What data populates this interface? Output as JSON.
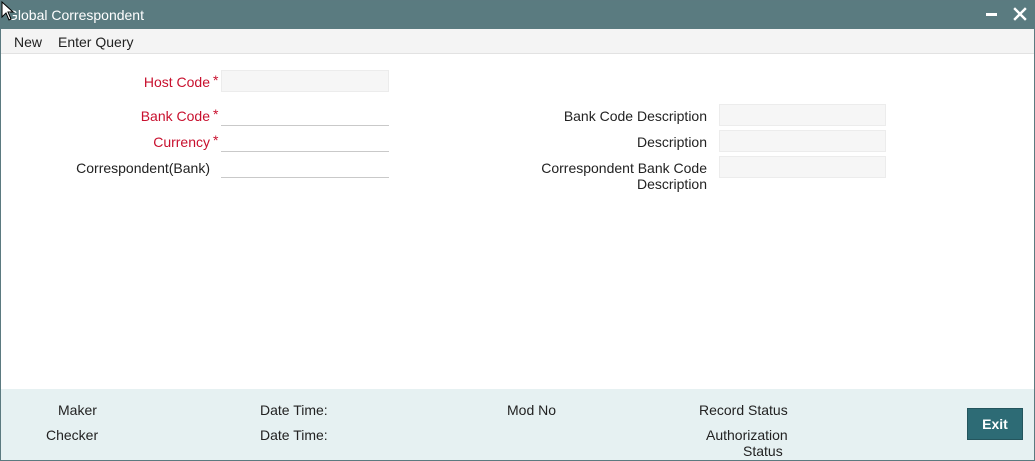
{
  "window": {
    "title": "Global Correspondent",
    "minimize_glyph": "▬",
    "close_glyph": "✕"
  },
  "menu": {
    "new": "New",
    "enter_query": "Enter Query"
  },
  "form": {
    "host_code": {
      "label": "Host Code",
      "required_mark": "*",
      "value": ""
    },
    "bank_code": {
      "label": "Bank Code",
      "required_mark": "*",
      "value": ""
    },
    "currency": {
      "label": "Currency",
      "required_mark": "*",
      "value": ""
    },
    "correspondent_bank": {
      "label": "Correspondent(Bank)",
      "value": ""
    },
    "bank_code_description": {
      "label": "Bank Code Description",
      "value": ""
    },
    "description": {
      "label": "Description",
      "value": ""
    },
    "correspondent_bank_code_description": {
      "label_line1": "Correspondent Bank Code",
      "label_line2": "Description",
      "value": ""
    }
  },
  "footer": {
    "maker": "Maker",
    "checker": "Checker",
    "date_time_1": "Date Time:",
    "date_time_2": "Date Time:",
    "mod_no": "Mod No",
    "record_status": "Record Status",
    "authorization_status_line1": "Authorization",
    "authorization_status_line2": "Status",
    "exit_label": "Exit"
  },
  "colors": {
    "titlebar": "#5a7b80",
    "required": "#c8102e",
    "footer_bg": "#e6f1f2",
    "exit_button": "#2d6b75"
  }
}
